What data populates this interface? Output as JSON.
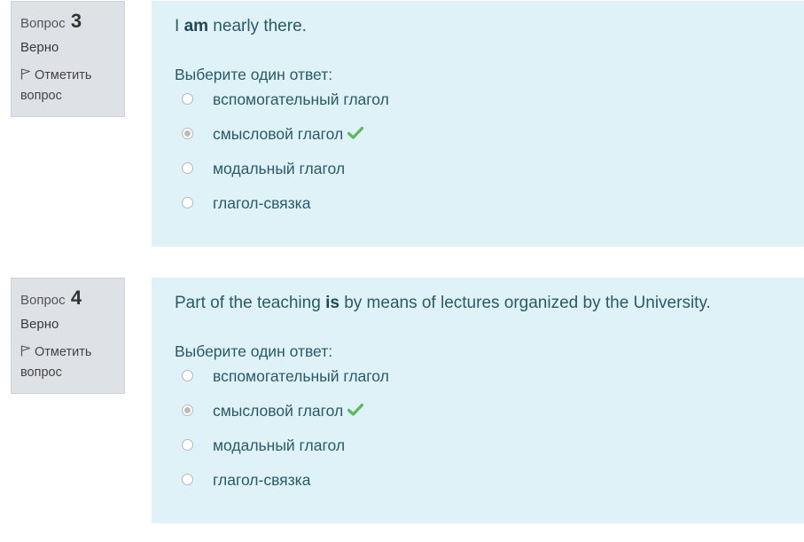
{
  "colors": {
    "info_bg": "#dee2e6",
    "content_bg": "#def2f8",
    "correct": "#5cb85c"
  },
  "questions": [
    {
      "label": "Вопрос",
      "number": "3",
      "state": "Верно",
      "flag_label": "Отметить вопрос",
      "text_before": "I ",
      "text_bold": "am",
      "text_after": " nearly there.",
      "prompt": "Выберите один ответ:",
      "answers": [
        {
          "label": "вспомогательный глагол",
          "checked": false,
          "correct": false
        },
        {
          "label": "смысловой глагол",
          "checked": true,
          "correct": true
        },
        {
          "label": "модальный глагол",
          "checked": false,
          "correct": false
        },
        {
          "label": "глагол-связка",
          "checked": false,
          "correct": false
        }
      ]
    },
    {
      "label": "Вопрос",
      "number": "4",
      "state": "Верно",
      "flag_label": "Отметить вопрос",
      "text_before": "Part of the teaching ",
      "text_bold": "is",
      "text_after": " by means of lectures organized by the University.",
      "prompt": "Выберите один ответ:",
      "answers": [
        {
          "label": "вспомогательный глагол",
          "checked": false,
          "correct": false
        },
        {
          "label": "смысловой глагол",
          "checked": true,
          "correct": true
        },
        {
          "label": "модальный глагол",
          "checked": false,
          "correct": false
        },
        {
          "label": "глагол-связка",
          "checked": false,
          "correct": false
        }
      ]
    }
  ]
}
